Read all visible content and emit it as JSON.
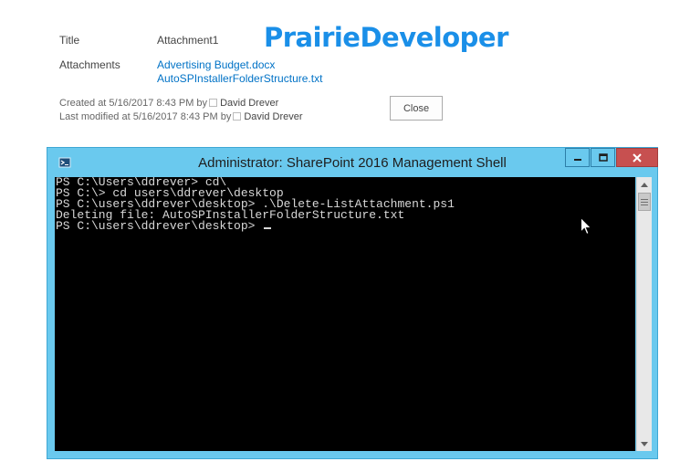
{
  "item": {
    "title_label": "Title",
    "title_value": "Attachment1",
    "attachments_label": "Attachments",
    "attachments": [
      "Advertising Budget.docx",
      "AutoSPInstallerFolderStructure.txt"
    ],
    "created": {
      "prefix": "Created at 5/16/2017 8:43 PM  by",
      "user": "David Drever"
    },
    "modified": {
      "prefix": "Last modified at 5/16/2017 8:43 PM  by",
      "user": "David Drever"
    },
    "close_label": "Close"
  },
  "brand": {
    "text": "PrairieDeveloper",
    "color": "#1a8fe8"
  },
  "shell": {
    "title": "Administrator: SharePoint 2016 Management Shell",
    "lines": [
      "PS C:\\Users\\ddrever> cd\\",
      "PS C:\\> cd users\\ddrever\\desktop",
      "PS C:\\users\\ddrever\\desktop> .\\Delete-ListAttachment.ps1",
      "Deleting file: AutoSPInstallerFolderStructure.txt",
      "PS C:\\users\\ddrever\\desktop> "
    ],
    "colors": {
      "titlebar": "#6ac9ee",
      "background": "#000000",
      "text": "#d8d8d8",
      "close_button": "#c75050"
    }
  }
}
